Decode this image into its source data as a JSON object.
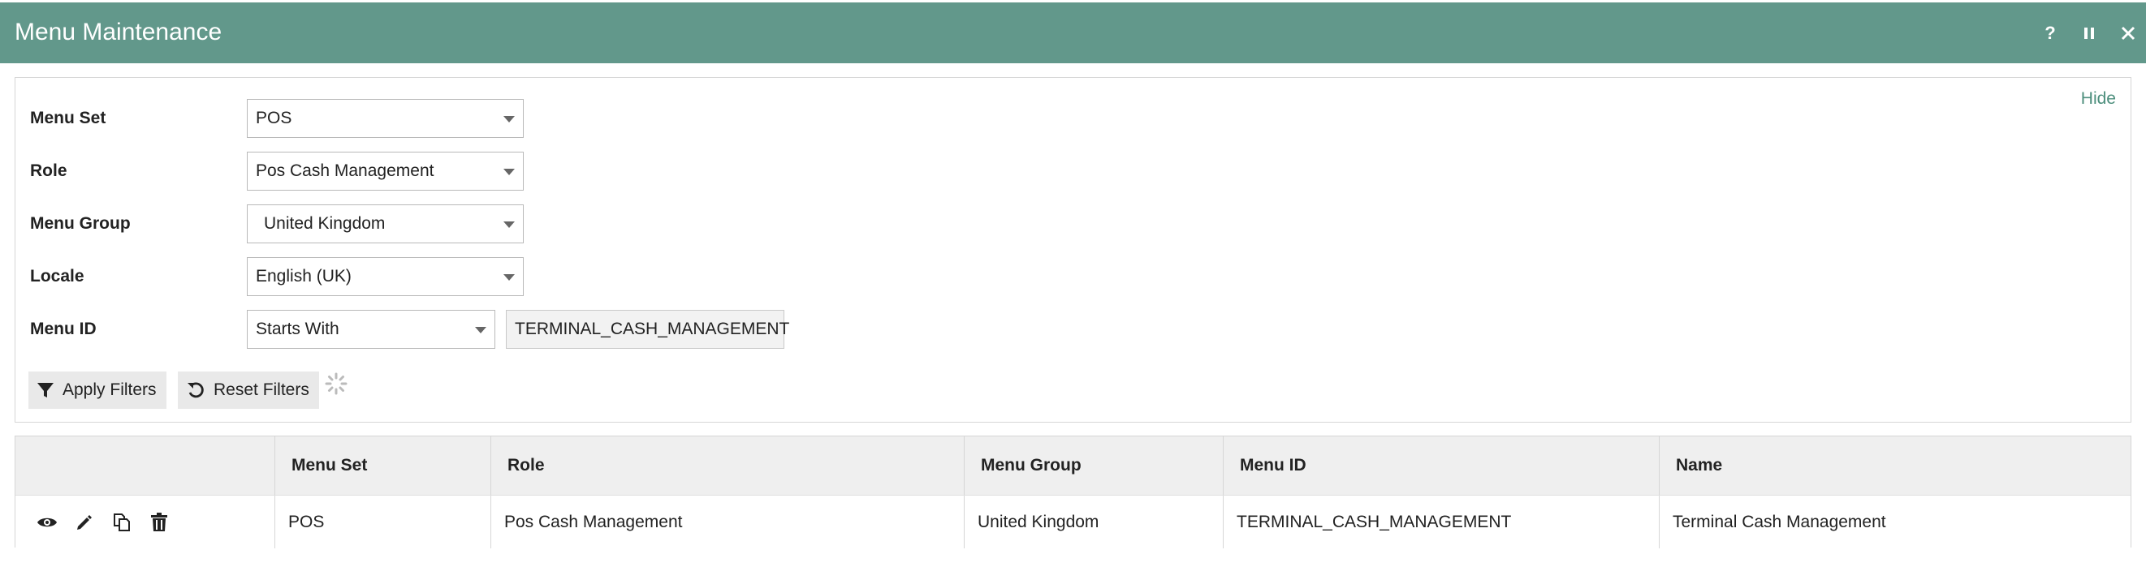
{
  "window": {
    "title": "Menu Maintenance",
    "icons": [
      "help-icon",
      "pause-icon",
      "close-icon"
    ],
    "help_glyph": "?"
  },
  "filters": {
    "hide_label": "Hide",
    "menu_set": {
      "label": "Menu Set",
      "value": "POS"
    },
    "role": {
      "label": "Role",
      "value": "Pos Cash Management"
    },
    "menu_group": {
      "label": "Menu Group",
      "value": "United Kingdom"
    },
    "locale": {
      "label": "Locale",
      "value": "English (UK)"
    },
    "menu_id": {
      "label": "Menu ID",
      "operator": "Starts With",
      "value": "TERMINAL_CASH_MANAGEMENT"
    },
    "apply_label": "Apply Filters",
    "reset_label": "Reset Filters"
  },
  "grid": {
    "columns": [
      "",
      "Menu Set",
      "Role",
      "Menu Group",
      "Menu ID",
      "Name"
    ],
    "rows": [
      {
        "actions": [
          "view-icon",
          "edit-icon",
          "copy-icon",
          "delete-icon"
        ],
        "menu_set": "POS",
        "role": "Pos Cash Management",
        "menu_group": "United Kingdom",
        "menu_id": "TERMINAL_CASH_MANAGEMENT",
        "name": "Terminal Cash Management"
      }
    ]
  },
  "colors": {
    "titlebar": "#62988b",
    "link": "#4d8f7d",
    "header_bg": "#efefef"
  }
}
